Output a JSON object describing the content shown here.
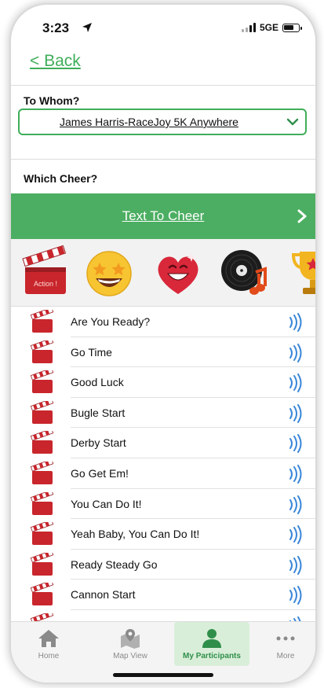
{
  "status": {
    "time": "3:23",
    "network": "5GE"
  },
  "nav": {
    "back_label": "< Back"
  },
  "recipient": {
    "label": "To Whom?",
    "selected": "James Harris-RaceJoy 5K Anywhere"
  },
  "cheer": {
    "label": "Which Cheer?",
    "banner_label": "Text To Cheer"
  },
  "emoji_categories": [
    "clapperboard-icon",
    "star-struck-face-icon",
    "heart-face-icon",
    "vinyl-record-icon",
    "trophy-icon"
  ],
  "cheer_items": [
    "Are You Ready?",
    "Go Time",
    "Good Luck",
    "Bugle Start",
    "Derby Start",
    "Go Get Em!",
    "You Can Do It!",
    "Yeah Baby, You Can Do It!",
    "Ready Steady Go",
    "Cannon Start"
  ],
  "clapper_text": "Action !",
  "tabs": [
    {
      "label": "Home",
      "icon": "home-icon",
      "active": false
    },
    {
      "label": "Map View",
      "icon": "map-pin-icon",
      "active": false
    },
    {
      "label": "My Participants",
      "icon": "person-icon",
      "active": true
    },
    {
      "label": "More",
      "icon": "more-dots-icon",
      "active": false
    }
  ],
  "colors": {
    "accent": "#4cae62",
    "accent_dark": "#2f8f4a",
    "sound": "#3a86d9"
  }
}
